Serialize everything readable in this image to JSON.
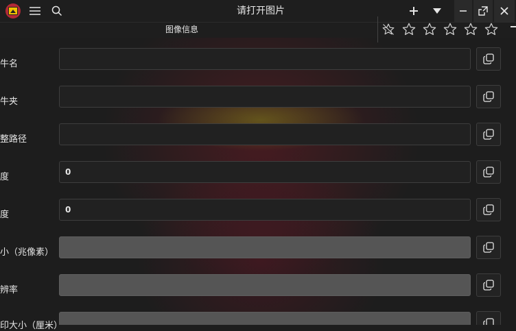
{
  "window": {
    "title": "请打开图片",
    "subtitle": "图像信息"
  },
  "rating": {
    "stars": 5,
    "value": 0
  },
  "rows": [
    {
      "label": "牛名",
      "value": "",
      "disabled": false
    },
    {
      "label": "牛夹",
      "value": "",
      "disabled": false
    },
    {
      "label": "整路径",
      "value": "",
      "disabled": false
    },
    {
      "label": "度",
      "value": "0",
      "disabled": false
    },
    {
      "label": "度",
      "value": "0",
      "disabled": false
    },
    {
      "label": "小（兆像素）",
      "value": "",
      "disabled": true
    },
    {
      "label": "辨率",
      "value": "",
      "disabled": true
    },
    {
      "label": "印大小（厘米）",
      "value": "",
      "disabled": true
    }
  ],
  "colors": {
    "background": "#1d1d1d",
    "field": "#212121",
    "field_disabled": "#555555",
    "accent_red": "#b32a36",
    "accent_yellow": "#f2c200"
  }
}
